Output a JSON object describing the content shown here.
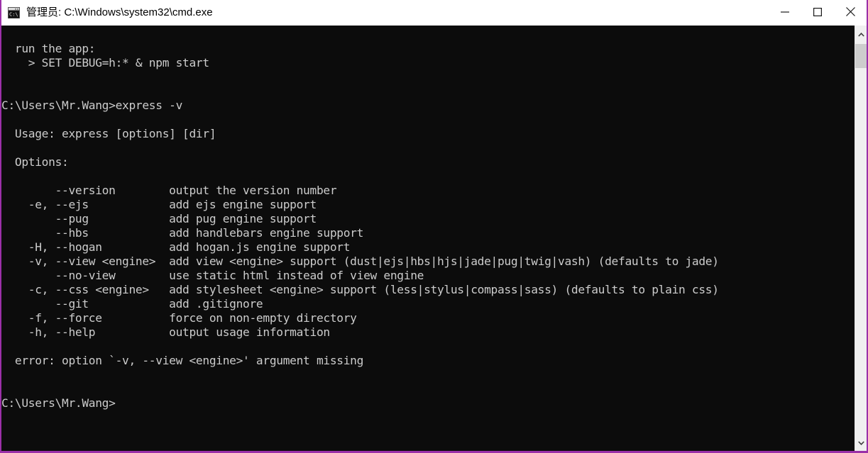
{
  "window": {
    "title": "管理员: C:\\Windows\\system32\\cmd.exe",
    "icon": "cmd-console-icon",
    "border_color": "#9B30A8",
    "titlebar_background": "#FFFFFF",
    "titlebar_text_color": "#000000"
  },
  "controls": {
    "minimize_label": "—",
    "maximize_label": "□",
    "close_label": "✕"
  },
  "console": {
    "background": "#0C0C0C",
    "foreground": "#CCCCCC",
    "lines": [
      "",
      "  run the app:",
      "    > SET DEBUG=h:* & npm start",
      "",
      "",
      "C:\\Users\\Mr.Wang>express -v",
      "",
      "  Usage: express [options] [dir]",
      "",
      "  Options:",
      "",
      "        --version        output the version number",
      "    -e, --ejs            add ejs engine support",
      "        --pug            add pug engine support",
      "        --hbs            add handlebars engine support",
      "    -H, --hogan          add hogan.js engine support",
      "    -v, --view <engine>  add view <engine> support (dust|ejs|hbs|hjs|jade|pug|twig|vash) (defaults to jade)",
      "        --no-view        use static html instead of view engine",
      "    -c, --css <engine>   add stylesheet <engine> support (less|stylus|compass|sass) (defaults to plain css)",
      "        --git            add .gitignore",
      "    -f, --force          force on non-empty directory",
      "    -h, --help           output usage information",
      "",
      "  error: option `-v, --view <engine>' argument missing",
      "",
      "",
      "C:\\Users\\Mr.Wang>"
    ]
  },
  "scrollbar": {
    "up_arrow": "chevron-up",
    "down_arrow": "chevron-down",
    "thumb_color": "#CDCDCD",
    "track_color": "#F0F0F0"
  }
}
